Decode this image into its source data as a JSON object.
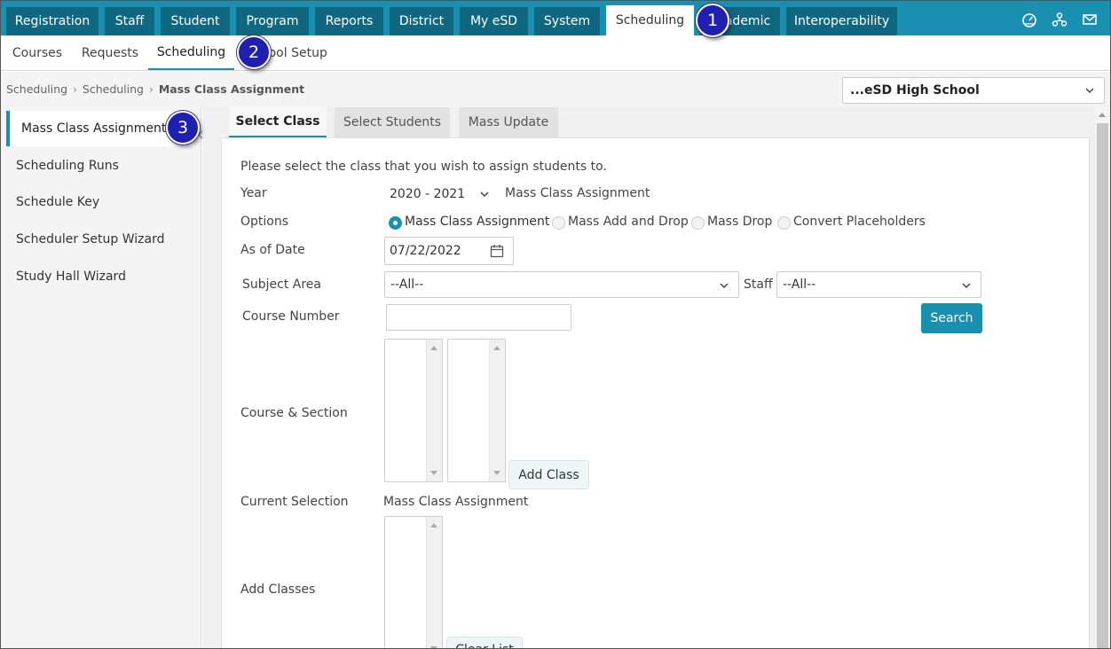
{
  "topnav": {
    "tabs": [
      "Registration",
      "Staff",
      "Student",
      "Program",
      "Reports",
      "District",
      "My eSD",
      "System",
      "Scheduling",
      "Academic",
      "Interoperability"
    ],
    "active": "Scheduling",
    "icons": [
      "dashboard-icon",
      "org-chart-icon",
      "mail-icon"
    ]
  },
  "subnav": {
    "items": [
      "Courses",
      "Requests",
      "Scheduling",
      "School Setup"
    ],
    "active": "Scheduling"
  },
  "breadcrumb": {
    "items": [
      "Scheduling",
      "Scheduling",
      "Mass Class Assignment"
    ]
  },
  "school_select": {
    "value": "...eSD High School"
  },
  "sidebar": {
    "items": [
      "Mass Class Assignment",
      "Scheduling Runs",
      "Schedule Key",
      "Scheduler Setup Wizard",
      "Study Hall Wizard"
    ],
    "active": "Mass Class Assignment"
  },
  "content_tabs": {
    "items": [
      "Select Class",
      "Select Students",
      "Mass Update"
    ],
    "active": "Select Class"
  },
  "form": {
    "instruction": "Please select the class that you wish to assign students to.",
    "year_label": "Year",
    "year_value": "2020 - 2021",
    "year_note": "Mass Class Assignment",
    "options_label": "Options",
    "options": [
      "Mass Class Assignment",
      "Mass Add and Drop",
      "Mass Drop",
      "Convert Placeholders"
    ],
    "options_selected": "Mass Class Assignment",
    "as_of_label": "As of Date",
    "as_of_value": "07/22/2022",
    "subject_label": "Subject Area",
    "subject_value": "--All--",
    "staff_label": "Staff",
    "staff_value": "--All--",
    "course_number_label": "Course Number",
    "course_number_value": "",
    "search_button": "Search",
    "course_section_label": "Course & Section",
    "add_class_button": "Add Class",
    "current_selection_label": "Current Selection",
    "current_selection_value": "Mass Class Assignment",
    "add_classes_label": "Add Classes",
    "clear_list_button": "Clear List"
  },
  "callouts": [
    "1",
    "2",
    "3"
  ],
  "colors": {
    "nav_bar": "#1a8fb0",
    "nav_tab": "#0f6880",
    "accent": "#1a8fb0",
    "callout": "#1f1fb0"
  }
}
